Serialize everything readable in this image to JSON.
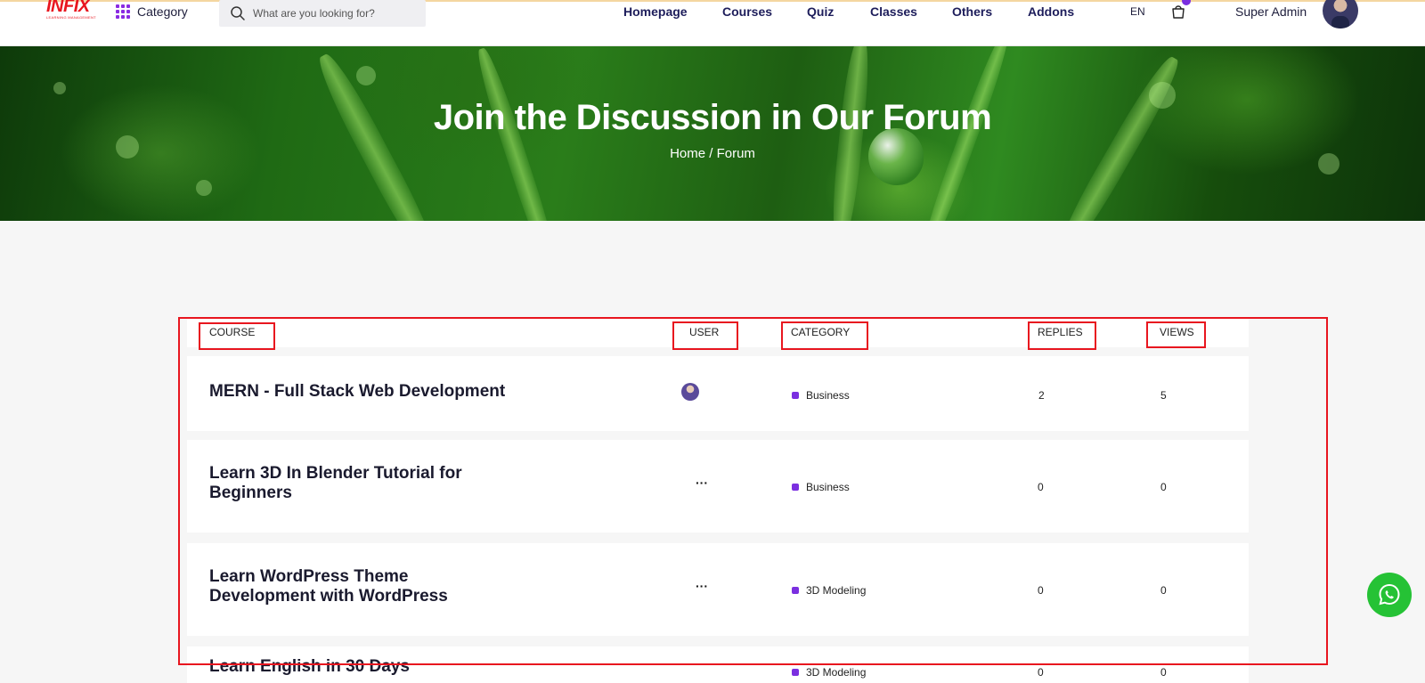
{
  "header": {
    "logo_text": "INFIX",
    "logo_subtext": "LEARNING MANAGEMENT",
    "category_label": "Category",
    "search_placeholder": "What are you looking for?",
    "nav": [
      "Homepage",
      "Courses",
      "Quiz",
      "Classes",
      "Others",
      "Addons"
    ],
    "language": "EN",
    "user_name": "Super Admin"
  },
  "banner": {
    "title": "Join the Discussion in Our Forum",
    "breadcrumb_home": "Home",
    "breadcrumb_sep": "/",
    "breadcrumb_current": "Forum"
  },
  "table": {
    "headers": {
      "course": "COURSE",
      "user": "USER",
      "category": "CATEGORY",
      "replies": "REPLIES",
      "views": "VIEWS"
    },
    "rows": [
      {
        "course": "MERN - Full Stack Web Development",
        "user": "avatar",
        "category": "Business",
        "replies": "2",
        "views": "5"
      },
      {
        "course": "Learn 3D In Blender Tutorial for Beginners",
        "user": "···",
        "category": "Business",
        "replies": "0",
        "views": "0"
      },
      {
        "course": "Learn WordPress Theme Development with WordPress",
        "user": "···",
        "category": "3D Modeling",
        "replies": "0",
        "views": "0"
      },
      {
        "course": "Learn English in 30 Days",
        "user": "···",
        "category": "3D Modeling",
        "replies": "0",
        "views": "0"
      }
    ]
  },
  "colors": {
    "accent_purple": "#7b2fe0",
    "brand_red": "#e8161f",
    "nav_text": "#1d1d5b",
    "whatsapp_green": "#25c235"
  },
  "icons": {
    "search": "search-icon",
    "category_grid": "grid-icon",
    "cart": "cart-icon",
    "whatsapp": "whatsapp-icon"
  }
}
